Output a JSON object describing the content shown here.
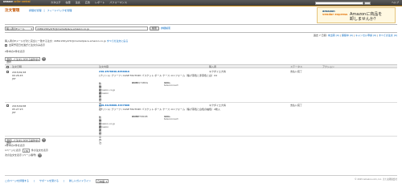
{
  "header": {
    "logo_main": "amazon",
    "logo_sub": "seller central",
    "nav": [
      "カタログ",
      "在庫",
      "注文",
      "広告",
      "レポート",
      "パフォーマンス"
    ],
    "help": "ヘルプ"
  },
  "page": {
    "title": "注文管理",
    "sublinks": [
      "評価を管理",
      "フィードバックを管理"
    ]
  },
  "promo": {
    "logo_line1": "amazon",
    "logo_line2": "vendor express",
    "text_line1": "Amazonに商品を",
    "text_line2": "卸しませんか？"
  },
  "search": {
    "scope": "購入者のEメール",
    "value": "d48br200y4r5l@marketplace.amazon.co.jp",
    "button": "検索",
    "advanced": "詳細検索"
  },
  "status_summary": {
    "prefix": "過去 7 日間:",
    "items": [
      "未出荷 (0)",
      "保留中 (0)",
      "キャンセル申請 (0)",
      "すべての注文 (0)"
    ]
  },
  "info": {
    "text": "購入者のEメールが次と完全に一致する注文: d48br200y4r5l@marketplace.amazon.co.jp",
    "reset_link": "すべての注文に戻る"
  },
  "filters": {
    "label": "出荷予定日を過ぎた注文のみ表示",
    "count_text": "2件中の2件を表示"
  },
  "bulk_action": {
    "select": "選択した注文に対する操作を選択",
    "go": "実行"
  },
  "table": {
    "columns": [
      "注文日時",
      "注文内容",
      "購入者",
      "ステータス",
      "アクション"
    ],
    "rows": [
      {
        "date": "2015/02/18",
        "time": "00:26:45 JST",
        "order_id": "249-9578846-8456816",
        "title": "(プリント) ブリーフ / CASE FACTORY バスケット ボール ケース ユニフォーム（焦げ茶色と赤茶色と白）X4",
        "qty_label": "数量:",
        "qty": "1",
        "asin_label": "ASIN:",
        "asin": "B00EQ74B0G",
        "sku_label": "SKU:",
        "sku": "abba-teleconnect",
        "shipping_label": "購入者の配送方法:",
        "shipping": "通常配送",
        "channel_label": "販売チャネル:",
        "channel": "Amazon.co.jp",
        "fulfilled_label": "出荷者:",
        "fulfilled": "Amazon",
        "buyer": "キクダイエ大将",
        "status": "支払い完了"
      },
      {
        "date": "2015/02/08",
        "time": "05:27:23 JST",
        "order_id": "249-6126808-3447808",
        "title": "(プリント) ブリーフ / CASE FACTORY バスケット ボール ケース ユニフォーム（焦げ茶色と白色の袖色）2枚入",
        "qty_label": "数量:",
        "qty": "1",
        "asin_label": "ASIN:",
        "asin": "B00BE58K0B",
        "sku_label": "SKU:",
        "sku": "abba-teleconnect",
        "shipping_label": "購入者の配送方法:",
        "shipping": "通常配送",
        "channel_label": "販売チャネル:",
        "channel": "amazon.co.jp",
        "fulfilled_label": "出荷者:",
        "fulfilled": "Amazon",
        "buyer": "キクダイエ大将",
        "status": "支払い完了"
      }
    ]
  },
  "pagination": {
    "label": "1ページに表示",
    "per_page": "15",
    "suffix": "件の注文を表示",
    "jump": "次の注文を表示 (ページ番号)"
  },
  "footer": {
    "links": [
      "このページを評価する",
      "サポートを受ける",
      "新しいガイドライン",
      "日本語"
    ],
    "copyright": "© 2015 Amazon.com, Inc. または関連会社"
  }
}
